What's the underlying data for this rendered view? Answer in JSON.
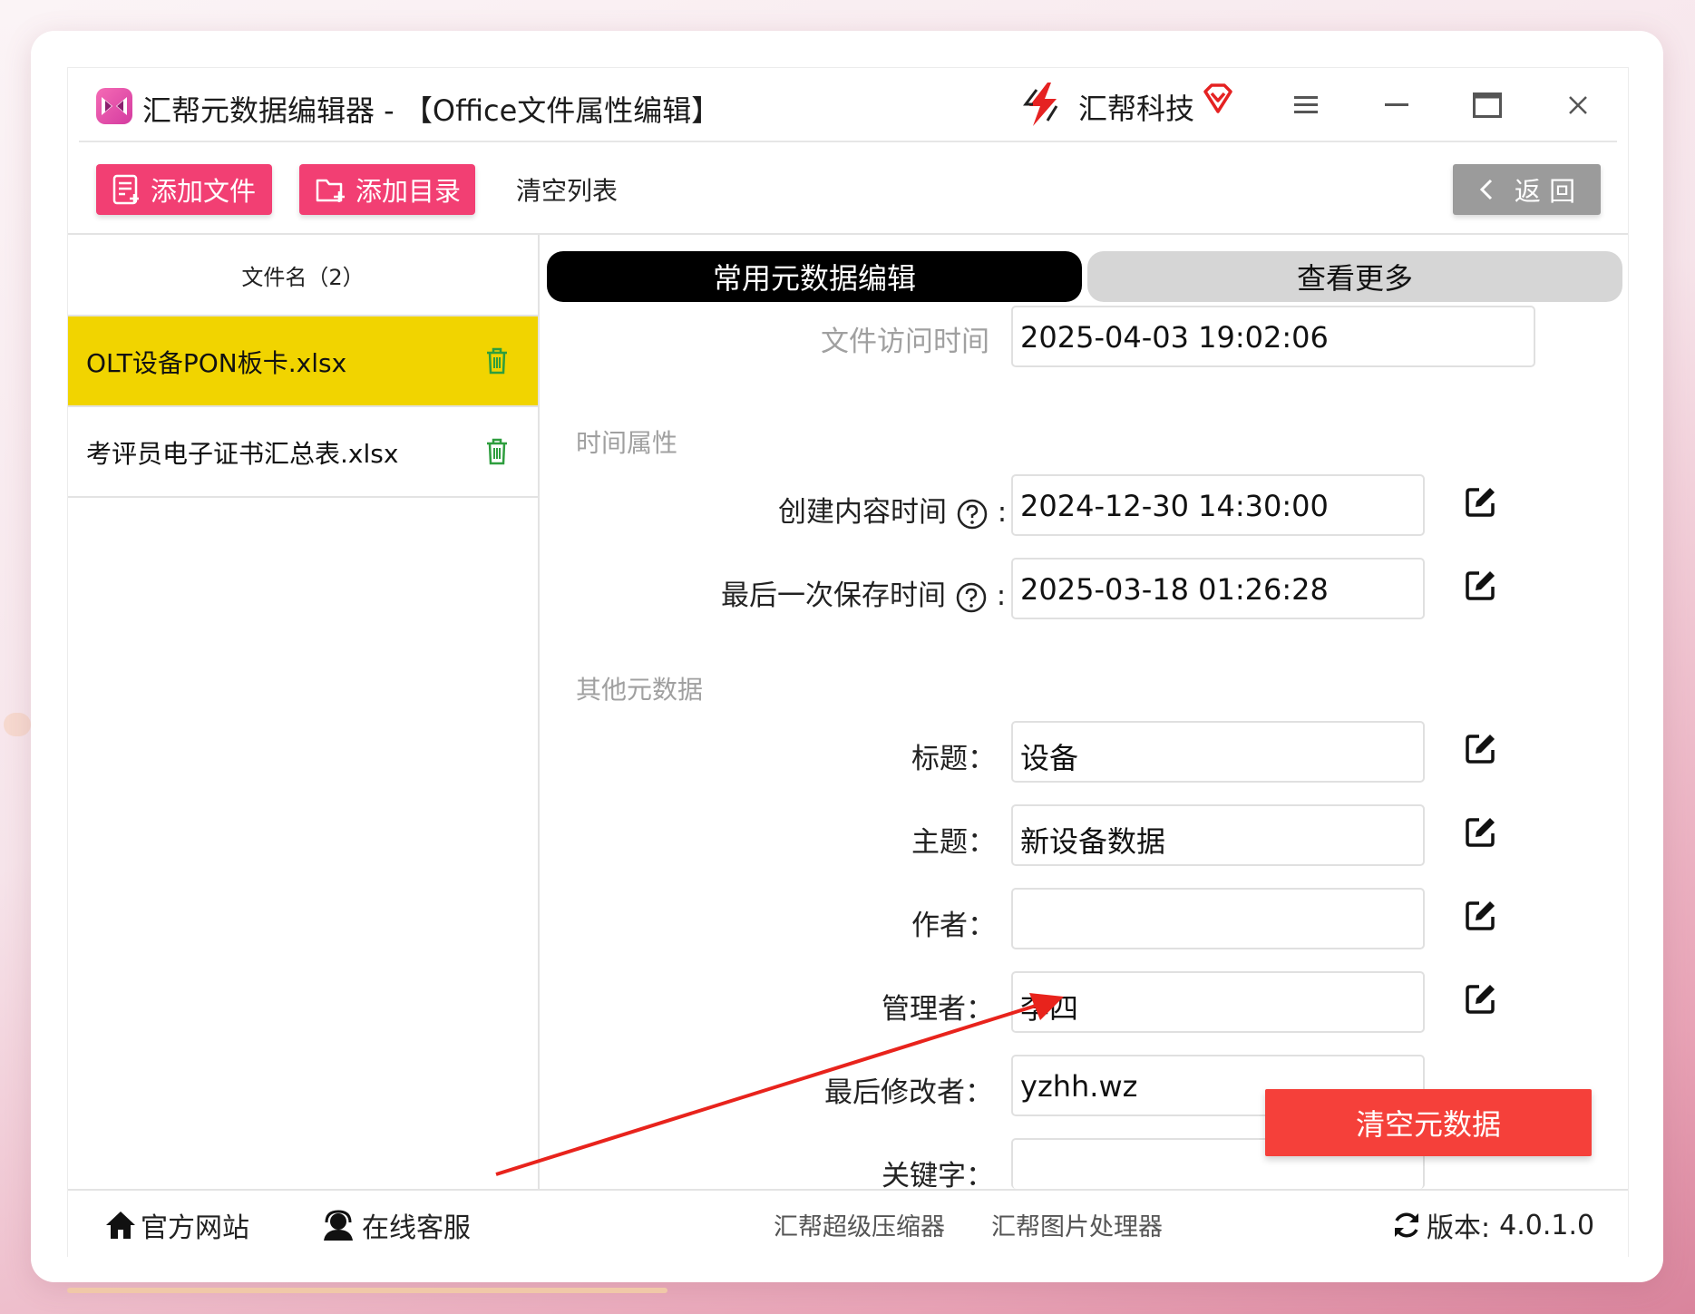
{
  "window": {
    "title": "汇帮元数据编辑器 - 【Office文件属性编辑】",
    "brand": "汇帮科技"
  },
  "toolbar": {
    "add_file": "添加文件",
    "add_dir": "添加目录",
    "clear_list": "清空列表",
    "back": "返 回"
  },
  "file_list": {
    "header": "文件名（2）",
    "files": [
      {
        "name": "OLT设备PON板卡.xlsx",
        "selected": true
      },
      {
        "name": "考评员电子证书汇总表.xlsx",
        "selected": false
      }
    ]
  },
  "tabs": {
    "active": "常用元数据编辑",
    "inactive": "查看更多"
  },
  "metadata": {
    "access_time": {
      "label": "文件访问时间",
      "value": "2025-04-03 19:02:06"
    },
    "time_section": "时间属性",
    "created": {
      "label": "创建内容时间",
      "value": "2024-12-30 14:30:00"
    },
    "last_saved": {
      "label": "最后一次保存时间",
      "value": "2025-03-18 01:26:28"
    },
    "colon": ":",
    "other_section": "其他元数据",
    "title": {
      "label": "标题：",
      "value": "设备"
    },
    "subject": {
      "label": "主题：",
      "value": "新设备数据"
    },
    "author": {
      "label": "作者：",
      "value": ""
    },
    "manager": {
      "label": "管理者：",
      "value": "李四"
    },
    "last_modified_by": {
      "label": "最后修改者：",
      "value": "yzhh.wz"
    },
    "keywords": {
      "label": "关键字：",
      "value": ""
    }
  },
  "actions": {
    "clear_metadata": "清空元数据"
  },
  "footer": {
    "website": "官方网站",
    "support": "在线客服",
    "compressor": "汇帮超级压缩器",
    "image_tool": "汇帮图片处理器",
    "version_label": "版本:",
    "version": "4.0.1.0"
  },
  "colors": {
    "accent_pink": "#f23f73",
    "selected_row": "#f1d400",
    "danger_red": "#f5403a",
    "trash_green": "#2e9e3e"
  }
}
